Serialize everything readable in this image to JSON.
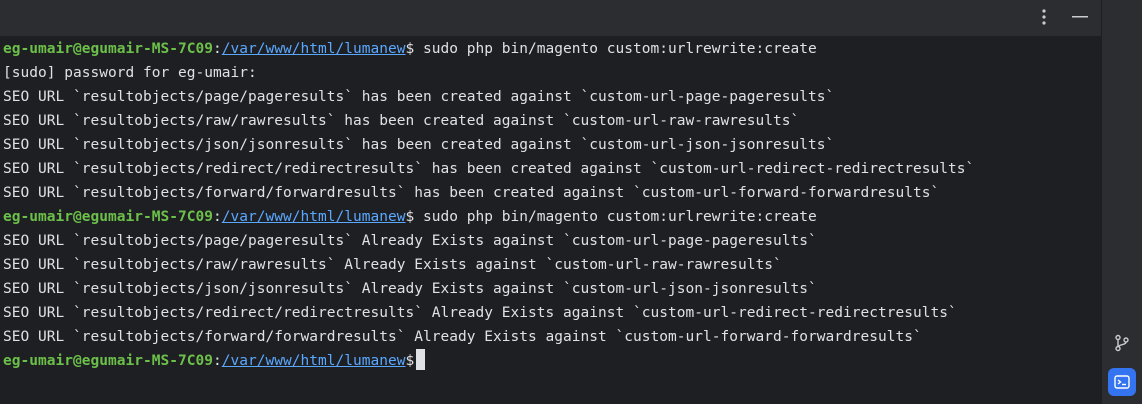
{
  "icons": {
    "more": "more-vertical-icon",
    "minimize": "minimize-icon",
    "git": "git-branch-icon",
    "terminal": "terminal-icon"
  },
  "colors": {
    "user": "#6cc04a",
    "path": "#5aa8ff",
    "text": "#dfe1e5",
    "terminal_bg": "#1e1f22",
    "accent": "#3574f0"
  },
  "prompt": {
    "user": "eg-umair@egumair-MS-7C09",
    "colon": ":",
    "path": "/var/www/html/lumanew",
    "symbol": "$"
  },
  "lines": [
    {
      "kind": "prompt",
      "command": " sudo php bin/magento custom:urlrewrite:create"
    },
    {
      "kind": "out",
      "text": "[sudo] password for eg-umair:"
    },
    {
      "kind": "out",
      "text": "SEO URL `resultobjects/page/pageresults` has been created against `custom-url-page-pageresults`"
    },
    {
      "kind": "out",
      "text": "SEO URL `resultobjects/raw/rawresults` has been created against `custom-url-raw-rawresults`"
    },
    {
      "kind": "out",
      "text": "SEO URL `resultobjects/json/jsonresults` has been created against `custom-url-json-jsonresults`"
    },
    {
      "kind": "out",
      "text": "SEO URL `resultobjects/redirect/redirectresults` has been created against `custom-url-redirect-redirectresults`"
    },
    {
      "kind": "out",
      "text": "SEO URL `resultobjects/forward/forwardresults` has been created against `custom-url-forward-forwardresults`"
    },
    {
      "kind": "prompt",
      "command": " sudo php bin/magento custom:urlrewrite:create"
    },
    {
      "kind": "out",
      "text": "SEO URL `resultobjects/page/pageresults` Already Exists against `custom-url-page-pageresults`"
    },
    {
      "kind": "out",
      "text": "SEO URL `resultobjects/raw/rawresults` Already Exists against `custom-url-raw-rawresults`"
    },
    {
      "kind": "out",
      "text": "SEO URL `resultobjects/json/jsonresults` Already Exists against `custom-url-json-jsonresults`"
    },
    {
      "kind": "out",
      "text": "SEO URL `resultobjects/redirect/redirectresults` Already Exists against `custom-url-redirect-redirectresults`"
    },
    {
      "kind": "out",
      "text": "SEO URL `resultobjects/forward/forwardresults` Already Exists against `custom-url-forward-forwardresults`"
    },
    {
      "kind": "prompt",
      "command": ""
    }
  ]
}
